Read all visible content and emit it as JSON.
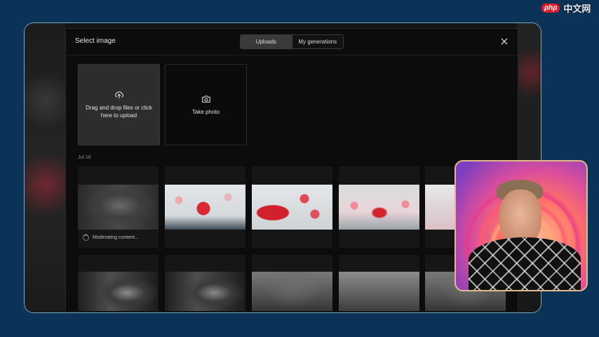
{
  "modal": {
    "title": "Select image",
    "tabs": [
      {
        "label": "Uploads",
        "active": true
      },
      {
        "label": "My generations",
        "active": false
      }
    ]
  },
  "upload_tile": {
    "text": "Drag and drop files or click here to upload",
    "icon": "cloud-upload-icon"
  },
  "photo_tile": {
    "text": "Take photo",
    "icon": "camera-icon"
  },
  "date_group": "Jul 16",
  "moderation_status": "Moderating content...",
  "watermark": {
    "badge": "php",
    "text": "中文网"
  },
  "colors": {
    "background": "#0b3357",
    "frame_border": "#7fa7c4",
    "modal": "#0c0c0c",
    "accent_red": "#d3212c",
    "webcam_border": "#e6b98c"
  }
}
